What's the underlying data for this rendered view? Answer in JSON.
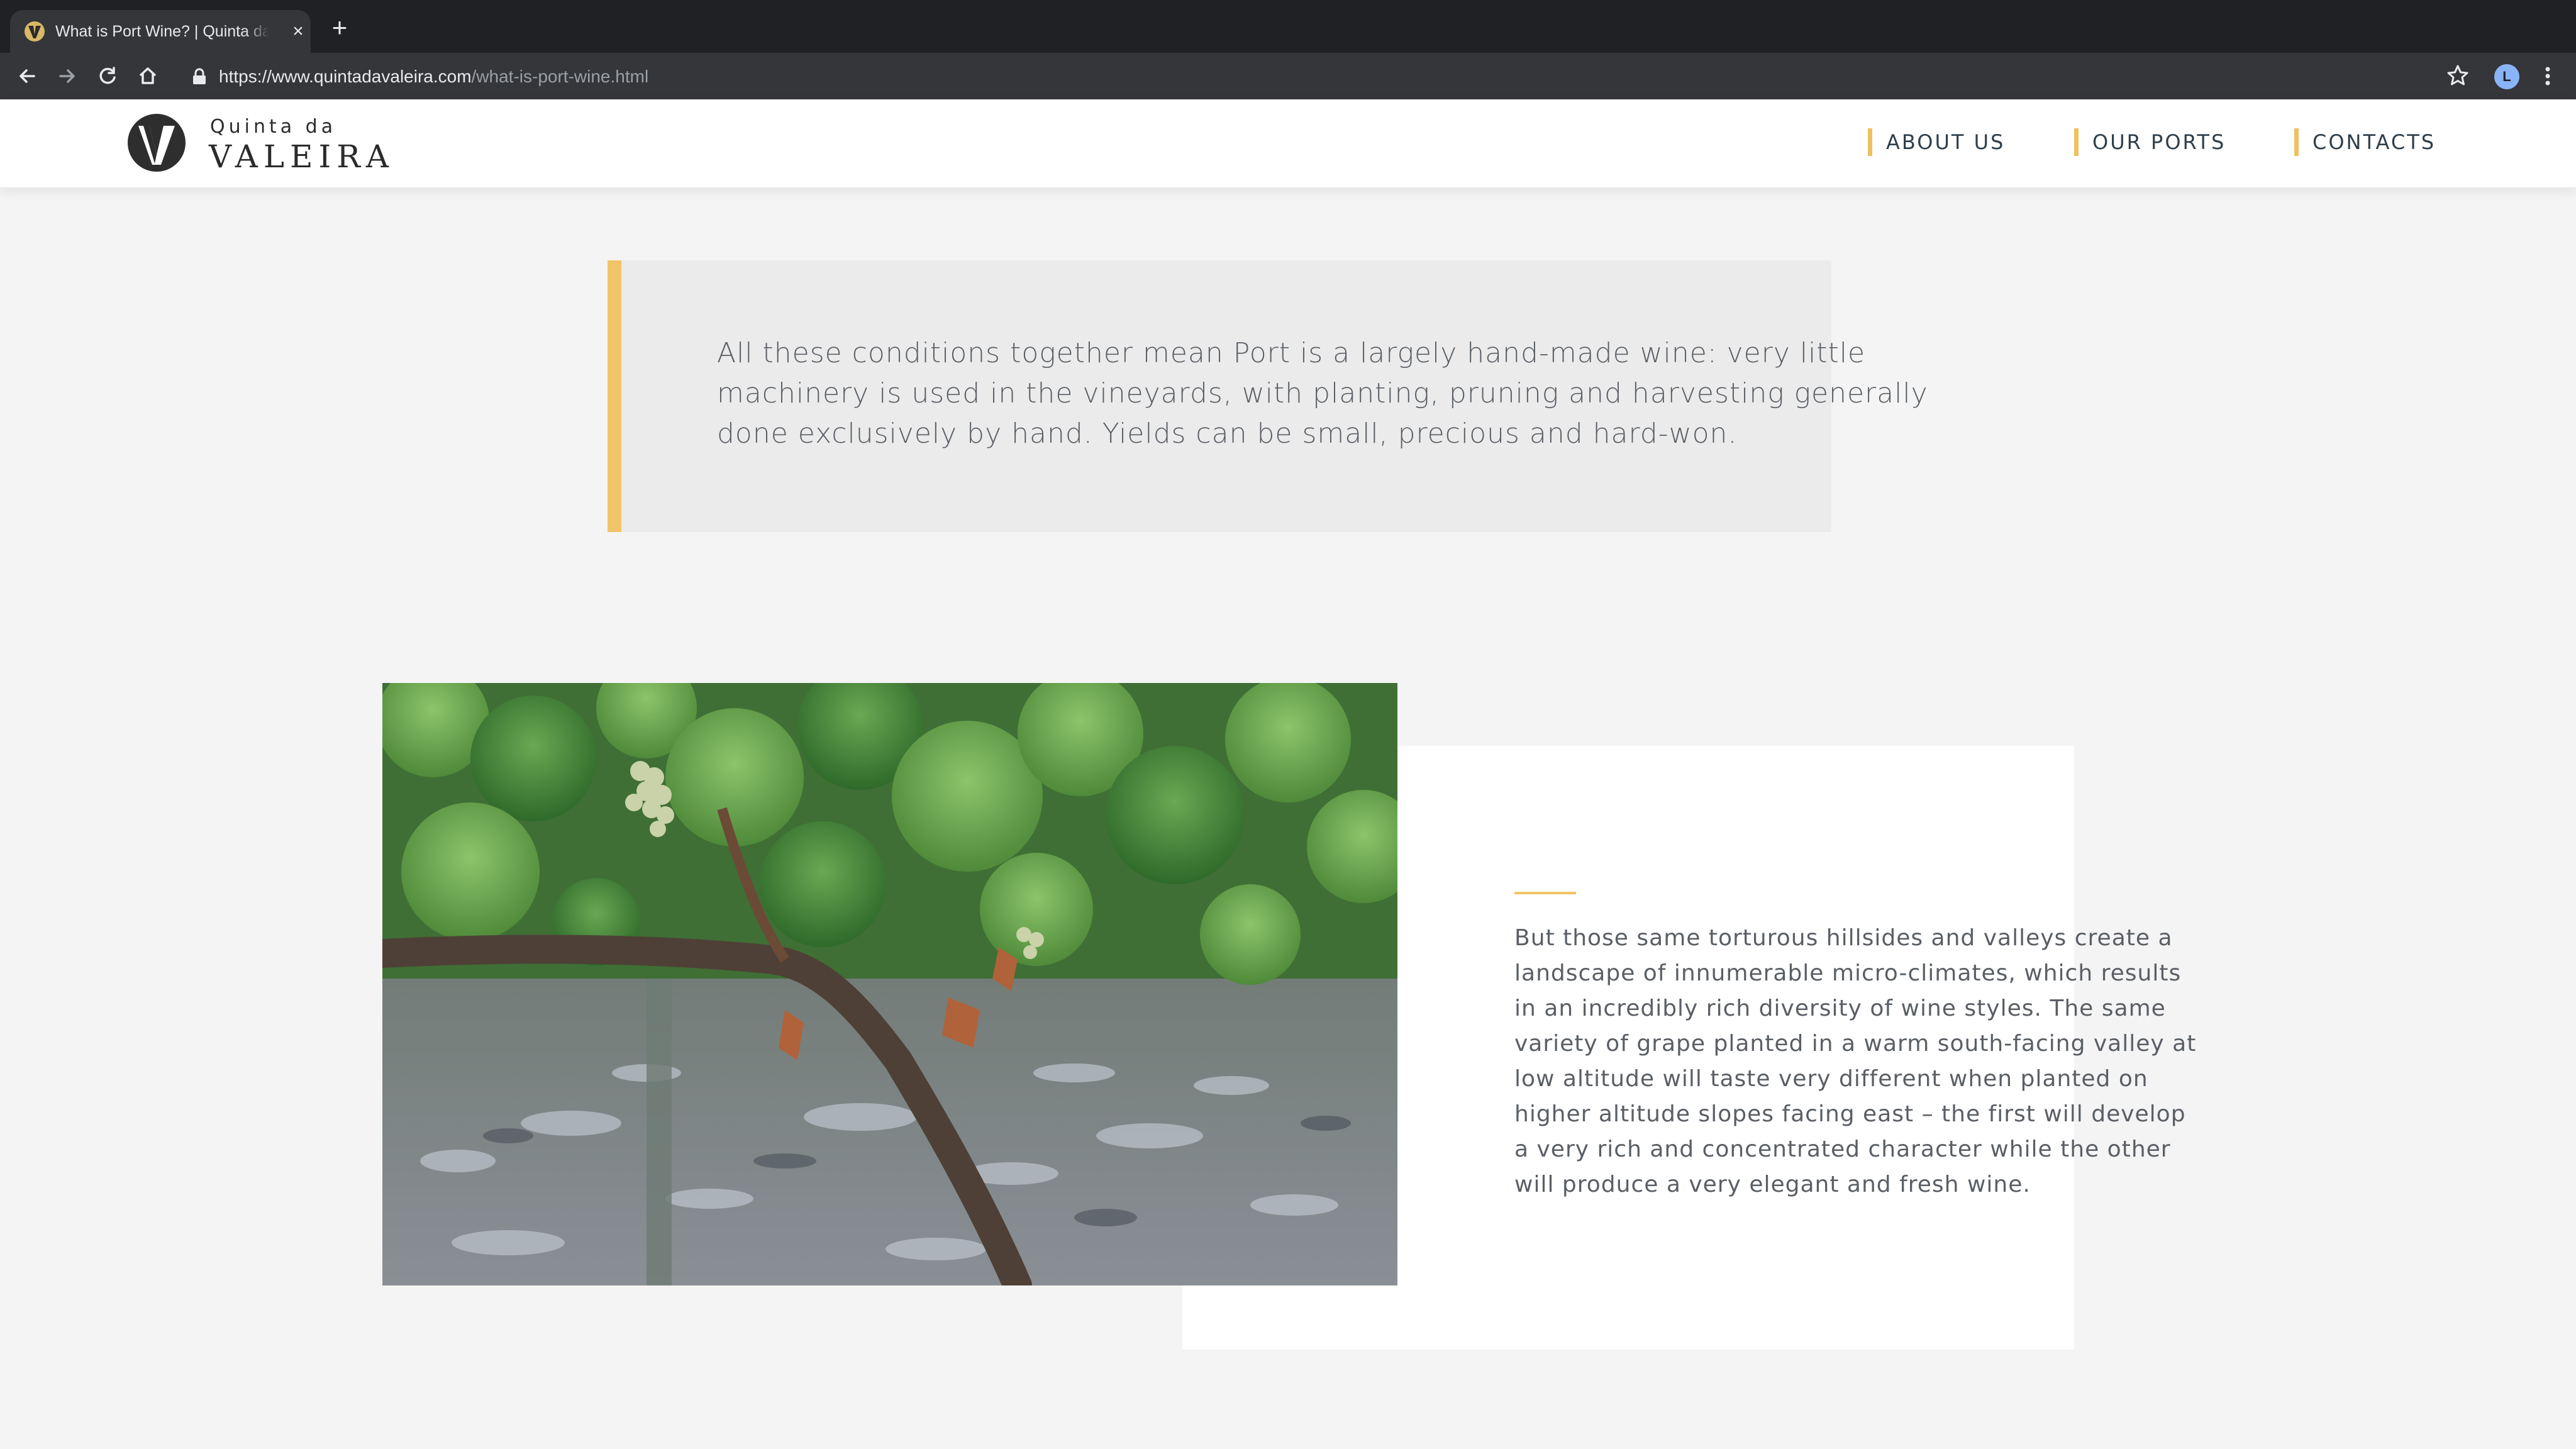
{
  "browser": {
    "tab_title": "What is Port Wine? | Quinta da Valeira",
    "url_host": "https://www.quintadavaleira.com",
    "url_path": "/what-is-port-wine.html",
    "profile_initial": "L",
    "icons": [
      "close-icon",
      "plus-icon",
      "back-icon",
      "forward-icon",
      "reload-icon",
      "home-icon",
      "lock-icon",
      "star-icon",
      "menu-icon"
    ]
  },
  "site": {
    "logo_small": "Quinta da",
    "logo_big": "VALEIRA",
    "nav": [
      {
        "label": "ABOUT US"
      },
      {
        "label": "OUR PORTS"
      },
      {
        "label": "CONTACTS"
      }
    ],
    "accent_color": "#f2c468"
  },
  "quote": {
    "text": "All these conditions together mean Port is a largely hand-made wine: very little machinery is used in the vineyards, with planting, pruning and harvesting generally done exclusively by hand. Yields can be small, precious and hard-won."
  },
  "feature": {
    "image_alt": "grapevine with green leaves and grape clusters",
    "text": "But those same torturous hillsides and valleys create a landscape of innumerable micro-climates, which results in an incredibly rich diversity of wine styles. The same variety of grape planted in a warm south-facing valley at low altitude will taste very different when planted on higher altitude slopes facing east – the first will develop a very rich and concentrated character while the other will produce a very elegant and fresh wine."
  }
}
